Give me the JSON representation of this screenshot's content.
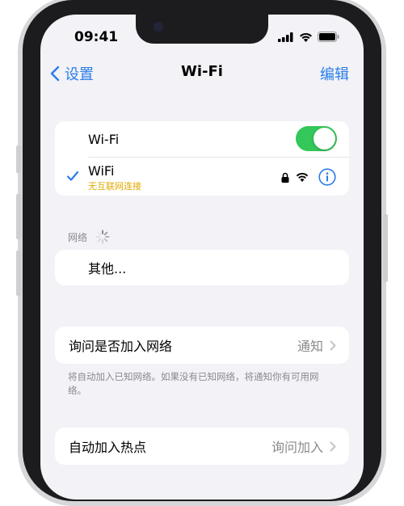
{
  "status_bar": {
    "time": "09:41"
  },
  "nav": {
    "back_label": "设置",
    "title": "Wi-Fi",
    "edit_label": "编辑"
  },
  "wifi_group": {
    "toggle_label": "Wi-Fi",
    "toggle_on": true,
    "connected_network": {
      "name": "WiFi",
      "status": "无互联网连接"
    }
  },
  "networks_section": {
    "header": "网络",
    "other_label": "其他..."
  },
  "ask_join": {
    "label": "询问是否加入网络",
    "value": "通知",
    "footnote": "将自动加入已知网络。如果没有已知网络，将通知你有可用网络。"
  },
  "auto_hotspot": {
    "label": "自动加入热点",
    "value": "询问加入"
  },
  "colors": {
    "accent": "#2b7de9",
    "toggle_on": "#34c759",
    "warning": "#e0a800"
  }
}
